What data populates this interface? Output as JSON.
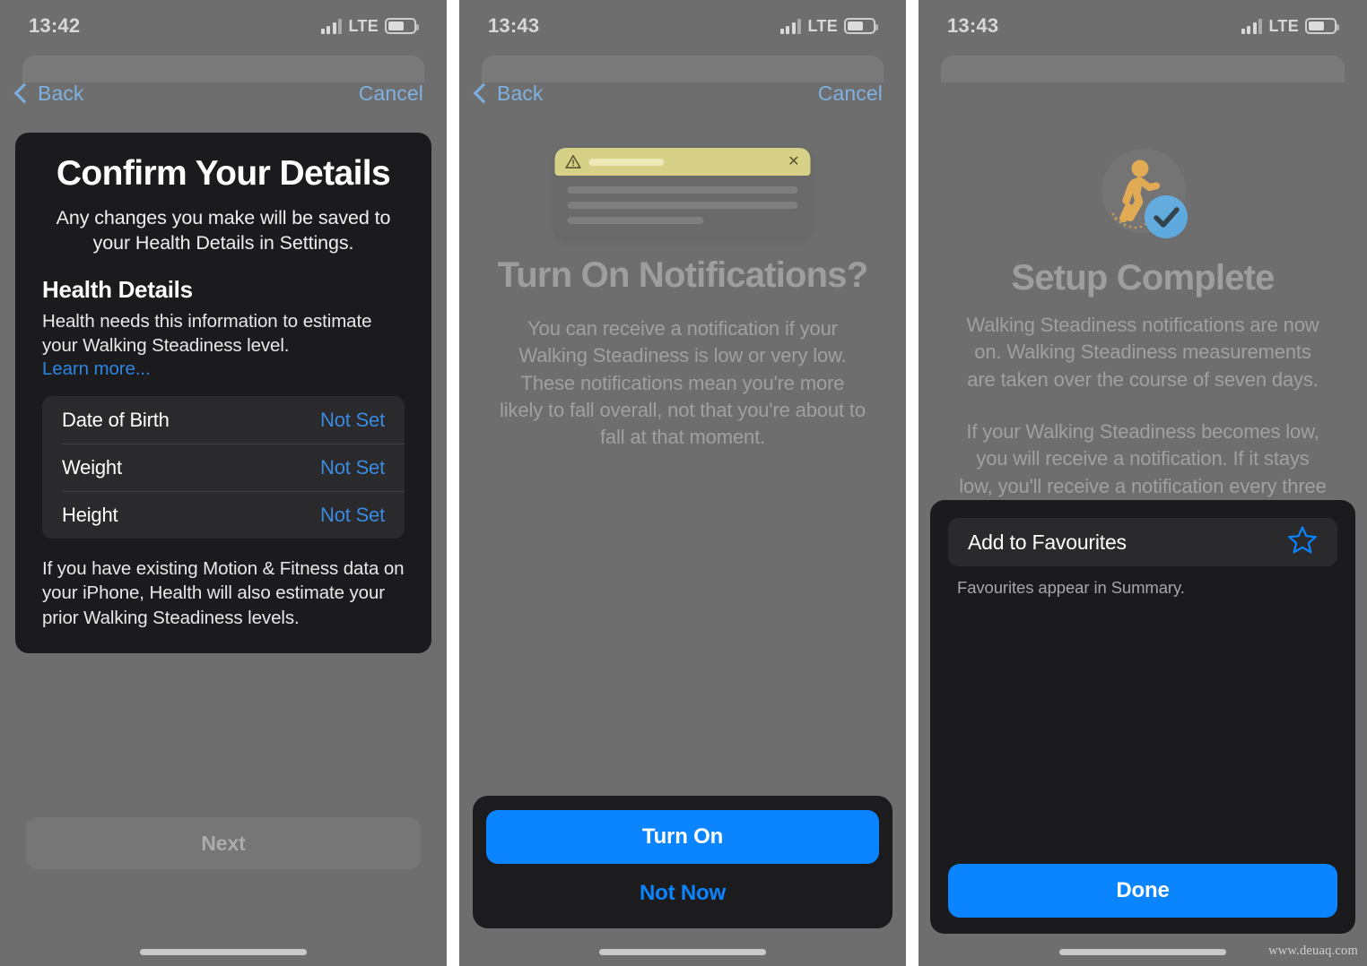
{
  "panels": [
    {
      "id": "confirm-details",
      "status": {
        "time": "13:42",
        "network": "LTE",
        "signal_icon": "cellular-bars-icon",
        "battery_icon": "battery-icon"
      },
      "nav": {
        "back_label": "Back",
        "cancel_label": "Cancel",
        "back_icon": "chevron-left-icon"
      },
      "card": {
        "title": "Confirm Your Details",
        "subtitle": "Any changes you make will be saved to your Health Details in Settings.",
        "section_heading": "Health Details",
        "section_body": "Health needs this information to estimate your Walking Steadiness level.",
        "learn_more": "Learn more...",
        "rows": [
          {
            "label": "Date of Birth",
            "value": "Not Set"
          },
          {
            "label": "Weight",
            "value": "Not Set"
          },
          {
            "label": "Height",
            "value": "Not Set"
          }
        ],
        "footer_note": "If you have existing Motion & Fitness data on your iPhone, Health will also estimate your prior Walking Steadiness levels."
      },
      "next_label": "Next"
    },
    {
      "id": "turn-on-notifications",
      "status": {
        "time": "13:43",
        "network": "LTE",
        "signal_icon": "cellular-bars-icon",
        "battery_icon": "battery-icon"
      },
      "nav": {
        "back_label": "Back",
        "cancel_label": "Cancel",
        "back_icon": "chevron-left-icon"
      },
      "illustration": {
        "name": "notification-banner-illustration",
        "warning_icon": "warning-triangle-icon",
        "close_icon": "close-x-icon"
      },
      "heading": "Turn On Notifications?",
      "body": "You can receive a notification if your Walking Steadiness is low or very low. These notifications mean you're more likely to fall overall, not that you're about to fall at that moment.",
      "primary_label": "Turn On",
      "secondary_label": "Not Now"
    },
    {
      "id": "setup-complete",
      "status": {
        "time": "13:43",
        "network": "LTE",
        "signal_icon": "cellular-bars-icon",
        "battery_icon": "battery-icon"
      },
      "illustration": {
        "name": "walking-steadiness-icon",
        "badge_icon": "check-circle-icon"
      },
      "heading": "Setup Complete",
      "body_1": "Walking Steadiness notifications are now on. Walking Steadiness measurements are taken over the course of seven days.",
      "body_2": "If your Walking Steadiness becomes low, you will receive a notification. If it stays low, you'll receive a notification every three months.",
      "favourites": {
        "label": "Add to Favourites",
        "star_icon": "star-outline-icon",
        "note": "Favourites appear in Summary."
      },
      "done_label": "Done"
    }
  ],
  "watermark": "www.deuaq.com",
  "colors": {
    "accent_blue": "#0a84ff",
    "link_blue": "#3a8ae0",
    "card_bg": "#1b1b1d",
    "list_bg": "#2a2a2c",
    "panel_bg": "#6e6e6e",
    "walk_icon_orange": "#e0a74e",
    "check_badge_blue": "#5ea9dd",
    "notif_header_yellow": "#d6d186"
  }
}
